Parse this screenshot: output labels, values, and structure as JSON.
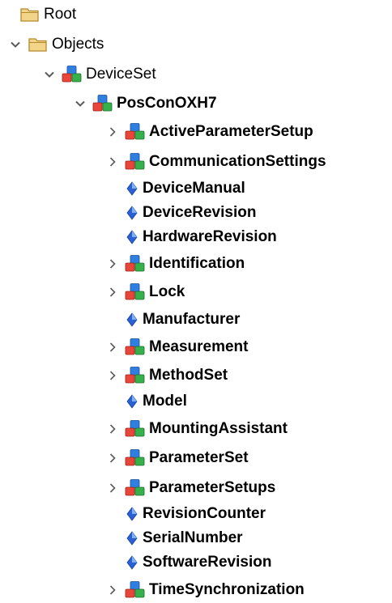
{
  "tree": [
    {
      "label": "Root",
      "icon": "folder-icon",
      "expander": "none",
      "depth": 0,
      "bold": false
    },
    {
      "label": "Objects",
      "icon": "folder-icon",
      "expander": "expanded",
      "depth": 1,
      "bold": false
    },
    {
      "label": "DeviceSet",
      "icon": "object-cubes-icon",
      "expander": "expanded",
      "depth": 2,
      "bold": false
    },
    {
      "label": "PosConOXH7",
      "icon": "object-cubes-icon",
      "expander": "expanded",
      "depth": 3,
      "bold": true
    },
    {
      "label": "ActiveParameterSetup",
      "icon": "object-cubes-icon",
      "expander": "collapsed",
      "depth": 4,
      "bold": true
    },
    {
      "label": "CommunicationSettings",
      "icon": "object-cubes-icon",
      "expander": "collapsed",
      "depth": 4,
      "bold": true
    },
    {
      "label": "DeviceManual",
      "icon": "property-diamond-icon",
      "expander": "none",
      "depth": 4,
      "bold": true
    },
    {
      "label": "DeviceRevision",
      "icon": "property-diamond-icon",
      "expander": "none",
      "depth": 4,
      "bold": true
    },
    {
      "label": "HardwareRevision",
      "icon": "property-diamond-icon",
      "expander": "none",
      "depth": 4,
      "bold": true
    },
    {
      "label": "Identification",
      "icon": "object-cubes-icon",
      "expander": "collapsed",
      "depth": 4,
      "bold": true
    },
    {
      "label": "Lock",
      "icon": "object-cubes-icon",
      "expander": "collapsed",
      "depth": 4,
      "bold": true
    },
    {
      "label": "Manufacturer",
      "icon": "property-diamond-icon",
      "expander": "none",
      "depth": 4,
      "bold": true
    },
    {
      "label": "Measurement",
      "icon": "object-cubes-icon",
      "expander": "collapsed",
      "depth": 4,
      "bold": true
    },
    {
      "label": "MethodSet",
      "icon": "object-cubes-icon",
      "expander": "collapsed",
      "depth": 4,
      "bold": true
    },
    {
      "label": "Model",
      "icon": "property-diamond-icon",
      "expander": "none",
      "depth": 4,
      "bold": true
    },
    {
      "label": "MountingAssistant",
      "icon": "object-cubes-icon",
      "expander": "collapsed",
      "depth": 4,
      "bold": true
    },
    {
      "label": "ParameterSet",
      "icon": "object-cubes-icon",
      "expander": "collapsed",
      "depth": 4,
      "bold": true
    },
    {
      "label": "ParameterSetups",
      "icon": "object-cubes-icon",
      "expander": "collapsed",
      "depth": 4,
      "bold": true
    },
    {
      "label": "RevisionCounter",
      "icon": "property-diamond-icon",
      "expander": "none",
      "depth": 4,
      "bold": true
    },
    {
      "label": "SerialNumber",
      "icon": "property-diamond-icon",
      "expander": "none",
      "depth": 4,
      "bold": true
    },
    {
      "label": "SoftwareRevision",
      "icon": "property-diamond-icon",
      "expander": "none",
      "depth": 4,
      "bold": true
    },
    {
      "label": "TimeSynchronization",
      "icon": "object-cubes-icon",
      "expander": "collapsed",
      "depth": 4,
      "bold": true
    }
  ],
  "colors": {
    "expander": "#5a5a5a",
    "folder_body": "#f3d58a",
    "folder_edge": "#b28a2e",
    "cube_red": "#e8463a",
    "cube_green": "#35b04a",
    "cube_blue": "#2f7fe0",
    "diamond_blue": "#2a62d6"
  }
}
